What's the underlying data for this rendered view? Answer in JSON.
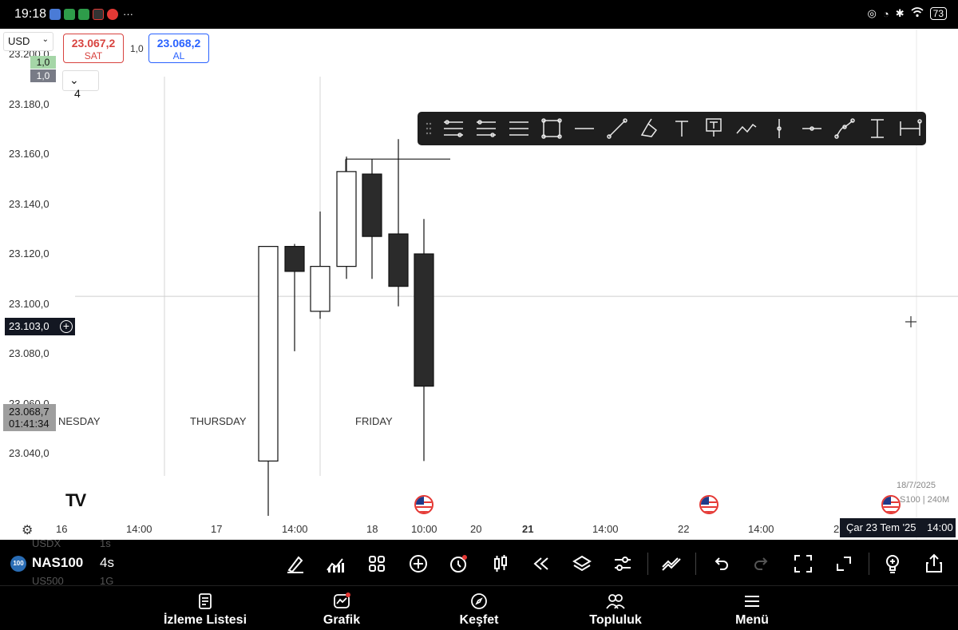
{
  "status": {
    "time": "19:18",
    "battery": "73",
    "more": "···"
  },
  "header": {
    "currency": "USD",
    "sell": {
      "price": "23.067,2",
      "label": "SAT"
    },
    "buy": {
      "price": "23.068,2",
      "label": "AL"
    },
    "spread": "1,0",
    "qty_top": "1,0",
    "qty_bottom": "1,0",
    "collapse_count": "4"
  },
  "chart_data": {
    "type": "candlestick",
    "symbol": "NAS100",
    "interval": "240M",
    "y_tick_labels": [
      "23.200,0",
      "23.180,0",
      "23.160,0",
      "23.140,0",
      "23.120,0",
      "23.100,0",
      "23.080,0",
      "23.060,0",
      "23.040,0"
    ],
    "x_tick_labels": [
      "16",
      "14:00",
      "17",
      "14:00",
      "18",
      "10:00",
      "20",
      "21",
      "14:00",
      "22",
      "14:00",
      "2"
    ],
    "session_labels": [
      "NESDAY",
      "THURSDAY",
      "FRIDAY"
    ],
    "candles": [
      {
        "open": 23037,
        "high": 23123,
        "low": 23007,
        "close": 23123,
        "direction": "up"
      },
      {
        "open": 23123,
        "high": 23124,
        "low": 23081,
        "close": 23113,
        "direction": "down"
      },
      {
        "open": 23097,
        "high": 23137,
        "low": 23094,
        "close": 23115,
        "direction": "up"
      },
      {
        "open": 23115,
        "high": 23159,
        "low": 23110,
        "close": 23153,
        "direction": "up"
      },
      {
        "open": 23152,
        "high": 23158,
        "low": 23110,
        "close": 23127,
        "direction": "down"
      },
      {
        "open": 23128,
        "high": 23166,
        "low": 23099,
        "close": 23107,
        "direction": "down"
      },
      {
        "open": 23120,
        "high": 23134,
        "low": 23037,
        "close": 23067,
        "direction": "down"
      }
    ],
    "drawn_level": 23158,
    "crosshair_price": "23.103,0",
    "last_price": "23.068,7",
    "countdown": "01:41:34",
    "crosshair_date": "Çar 23 Tem '25",
    "crosshair_time": "14:00",
    "info_date": "18/7/2025",
    "info_symbol": "S100 | 240M",
    "colors": {
      "up_body": "#ffffff",
      "down_body": "#2b2b2b",
      "wick": "#111111"
    }
  },
  "drawing_toolbar": [
    "parallel-channel-icon",
    "regression-trend-icon",
    "fib-retracement-icon",
    "rectangle-icon",
    "horizontal-line-icon",
    "trend-line-icon",
    "brush-icon",
    "text-icon",
    "text-note-icon",
    "pitchfork-icon",
    "vertical-line-icon",
    "horizontal-ray-icon",
    "path-icon",
    "price-range-icon",
    "date-range-icon"
  ],
  "bottom_bar": {
    "symbol": "NAS100",
    "symbol_badge": "100",
    "interval": "4s",
    "ghost_above": "USDX",
    "ghost_above_int": "1s",
    "ghost_below": "US500",
    "ghost_below_int": "1G"
  },
  "nav": [
    {
      "label": "İzleme Listesi",
      "icon": "watchlist-icon"
    },
    {
      "label": "Grafik",
      "icon": "chart-icon"
    },
    {
      "label": "Keşfet",
      "icon": "compass-icon"
    },
    {
      "label": "Topluluk",
      "icon": "community-icon"
    },
    {
      "label": "Menü",
      "icon": "menu-icon"
    }
  ]
}
